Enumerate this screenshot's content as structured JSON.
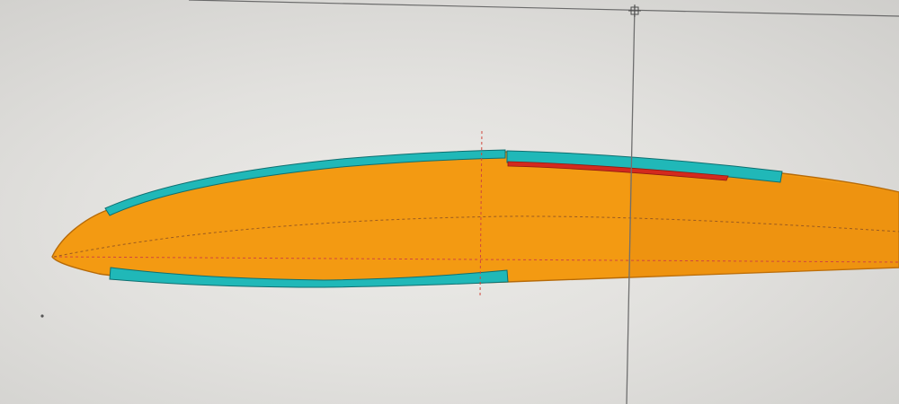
{
  "app": {
    "view": "airfoil-section-editor"
  },
  "colors": {
    "background": "#e4e3e0",
    "airfoil_fill": "#f39a12",
    "airfoil_stroke": "#b86a08",
    "spar_cap": "#20b8b8",
    "reinforcement": "#d32a1e",
    "guide_line": "#6f6f6f",
    "construction_line": "#e0403a"
  },
  "icons": {
    "cursor": "crosshair-cursor-icon"
  },
  "layers": [
    {
      "name": "airfoil-profile",
      "color": "#f39a12"
    },
    {
      "name": "upper-spar-cap",
      "color": "#20b8b8"
    },
    {
      "name": "lower-spar-cap",
      "color": "#20b8b8"
    },
    {
      "name": "reinforcement-strip",
      "color": "#d32a1e"
    }
  ]
}
